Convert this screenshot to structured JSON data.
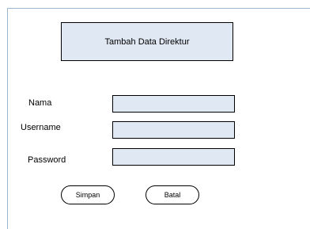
{
  "form": {
    "title": "Tambah Data Direktur",
    "fields": [
      {
        "label": "Nama",
        "value": ""
      },
      {
        "label": "Username",
        "value": ""
      },
      {
        "label": "Password",
        "value": ""
      }
    ],
    "buttons": {
      "save_label": "Simpan",
      "cancel_label": "Batal"
    }
  },
  "colors": {
    "box_fill": "#e0e8f3",
    "frame_line": "#9bb7d6",
    "border": "#000000"
  }
}
